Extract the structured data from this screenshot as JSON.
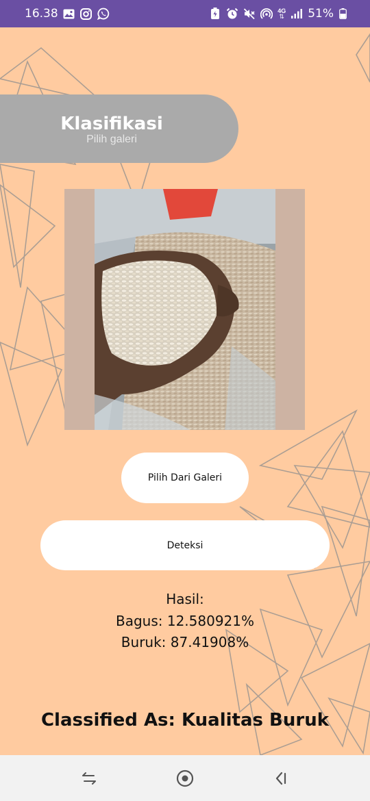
{
  "status_bar": {
    "time": "16.38",
    "network": "4G",
    "battery": "51%",
    "left_icons": [
      "gallery-icon",
      "instagram-icon",
      "whatsapp-icon"
    ],
    "right_icons": [
      "battery-saver-icon",
      "alarm-icon",
      "mute-icon",
      "hotspot-icon",
      "signal-icon",
      "battery-icon"
    ]
  },
  "header": {
    "title": "Klasifikasi",
    "subtitle": "Pilih galeri"
  },
  "image": {
    "content": "rice-in-hand-photo"
  },
  "buttons": {
    "gallery_label": "Pilih Dari Galeri",
    "detect_label": "Deteksi"
  },
  "result": {
    "title": "Hasil:",
    "bagus": "Bagus: 12.580921%",
    "buruk": "Buruk: 87.41908%"
  },
  "classification": {
    "text": "Classified As: Kualitas Buruk"
  },
  "nav_bar": {
    "icons": [
      "recent-apps-icon",
      "home-icon",
      "back-icon"
    ]
  },
  "colors": {
    "background": "#ffcba0",
    "status_bar": "#6a4fa3",
    "title_pill": "#aaaaaa",
    "button": "#ffffff",
    "nav_bar": "#f2f2f2"
  }
}
